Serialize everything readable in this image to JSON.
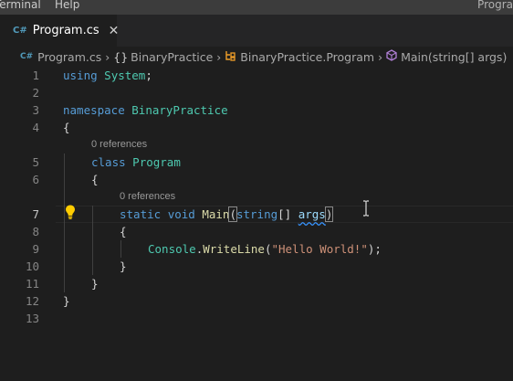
{
  "menubar": {
    "items": [
      "Terminal",
      "Help"
    ],
    "title_right": "Progra"
  },
  "tab": {
    "icon": "C#",
    "label": "Program.cs"
  },
  "breadcrumb": {
    "file": "Program.cs",
    "namespace_icon": "{}",
    "namespace": "BinaryPractice",
    "class": "BinaryPractice.Program",
    "method": "Main(string[] args)"
  },
  "editor": {
    "line_numbers": [
      "1",
      "2",
      "3",
      "4",
      "5",
      "6",
      "7",
      "8",
      "9",
      "10",
      "11",
      "12",
      "13"
    ],
    "active_line": "7",
    "codelens": [
      "0 references",
      "0 references"
    ],
    "tokens": {
      "using": "using",
      "system": "System",
      "namespace": "namespace",
      "ns_name": "BinaryPractice",
      "open_brace": "{",
      "close_brace": "}",
      "class": "class",
      "class_name": "Program",
      "static": "static",
      "void": "void",
      "main": "Main",
      "open_paren": "(",
      "close_paren": ")",
      "string": "string",
      "array": "[]",
      "args": "args",
      "console": "Console",
      "dot": ".",
      "writeline": "WriteLine",
      "hello": "\"Hello World!\"",
      "semicolon": ";"
    }
  },
  "colors": {
    "keyword": "#569cd6",
    "type": "#4ec9b0",
    "function": "#dcdcaa",
    "parameter": "#9cdcfe",
    "string": "#ce9178",
    "lightbulb": "#ffcc00"
  }
}
